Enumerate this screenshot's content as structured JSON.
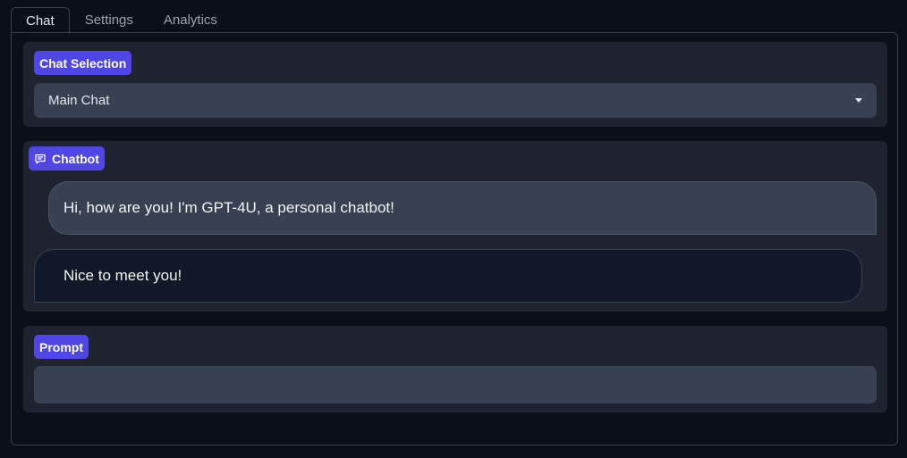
{
  "tabs": [
    {
      "label": "Chat",
      "active": true
    },
    {
      "label": "Settings",
      "active": false
    },
    {
      "label": "Analytics",
      "active": false
    }
  ],
  "chat_selection": {
    "label": "Chat Selection",
    "selected": "Main Chat"
  },
  "chatbot": {
    "label": "Chatbot",
    "icon": "chat-bubble-icon",
    "messages": [
      {
        "role": "bot",
        "text": "Hi, how are you! I'm GPT-4U, a personal chatbot!"
      },
      {
        "role": "user",
        "text": "Nice to meet you!"
      }
    ]
  },
  "prompt": {
    "label": "Prompt",
    "value": "",
    "placeholder": ""
  },
  "colors": {
    "background": "#0b0f19",
    "block": "#1f2330",
    "accent": "#4f46e5",
    "input": "#374151"
  }
}
